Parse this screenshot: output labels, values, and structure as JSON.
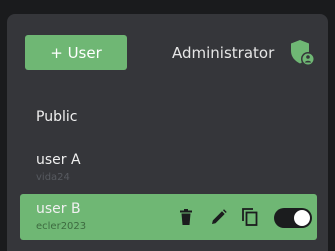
{
  "header": {
    "add_user_label": "+ User",
    "role_label": "Administrator",
    "role_icon": "admin-shield-icon"
  },
  "users": [
    {
      "name": "Public",
      "subtitle": ""
    },
    {
      "name": "user A",
      "subtitle": "vida24"
    },
    {
      "name": "user B",
      "subtitle": "ecler2023",
      "selected": true,
      "enabled": true
    }
  ],
  "actions": {
    "icons": [
      "trash-icon",
      "pencil-icon",
      "copy-icon"
    ],
    "toggle": "enabled"
  },
  "colors": {
    "background": "#1a1b1d",
    "panel": "#35363a",
    "accent": "#6fb774",
    "text": "#f0f0f0"
  }
}
